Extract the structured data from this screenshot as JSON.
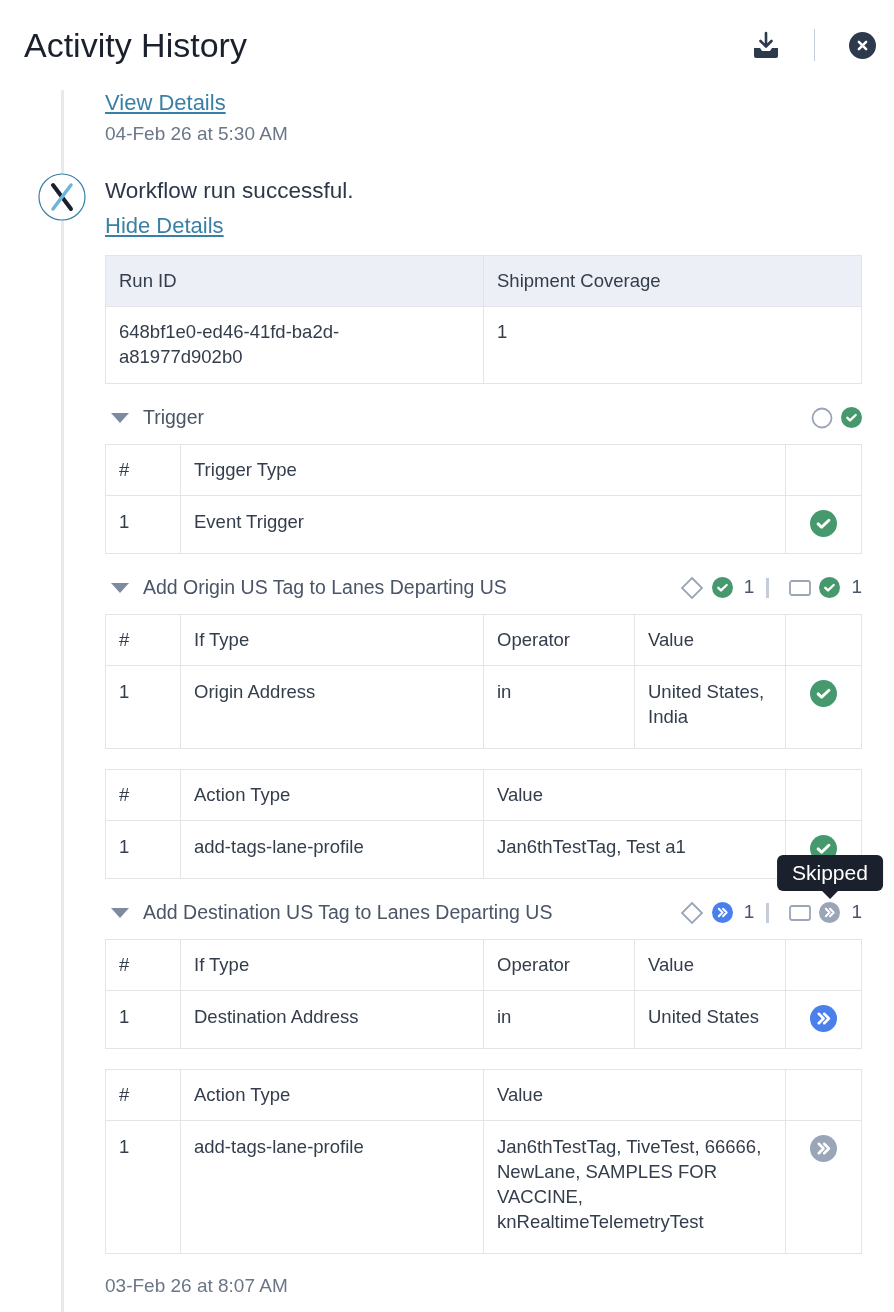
{
  "header": {
    "title": "Activity History"
  },
  "previous_entry": {
    "link": "View Details",
    "timestamp": "04-Feb 26 at 5:30 AM"
  },
  "entry": {
    "message": "Workflow run successful.",
    "link": "Hide Details",
    "timestamp": "03-Feb 26 at 8:07 AM",
    "run_table": {
      "columns": [
        "Run ID",
        "Shipment Coverage"
      ],
      "rows": [
        [
          "648bf1e0-ed46-41fd-ba2d-a81977d902b0",
          "1"
        ]
      ]
    },
    "sections": [
      {
        "title": "Trigger",
        "expanded": true,
        "indicators": [
          {
            "kind": "trigger",
            "icon": {
              "kind": "check",
              "color": "#46996c"
            }
          }
        ],
        "tables": [
          {
            "kind": "trigger",
            "columns": [
              "#",
              "Trigger Type"
            ],
            "rows": [
              {
                "cells": [
                  "1",
                  "Event Trigger"
                ],
                "icon": {
                  "kind": "check",
                  "color": "#46996c"
                }
              }
            ]
          }
        ]
      },
      {
        "title": "Add Origin US Tag to Lanes Departing US",
        "expanded": true,
        "indicators": [
          {
            "kind": "condition",
            "icon": {
              "kind": "check",
              "color": "#46996c"
            },
            "count": "1"
          },
          {
            "kind": "action",
            "icon": {
              "kind": "check",
              "color": "#46996c"
            },
            "count": "1"
          }
        ],
        "tables": [
          {
            "kind": "condition",
            "columns": [
              "#",
              "If Type",
              "Operator",
              "Value"
            ],
            "rows": [
              {
                "cells": [
                  "1",
                  "Origin Address",
                  "in",
                  "United States, India"
                ],
                "icon": {
                  "kind": "check",
                  "color": "#46996c"
                }
              }
            ]
          },
          {
            "kind": "action",
            "columns": [
              "#",
              "Action Type",
              "Value"
            ],
            "rows": [
              {
                "cells": [
                  "1",
                  "add-tags-lane-profile",
                  "Jan6thTestTag, Test a1"
                ],
                "icon": {
                  "kind": "check",
                  "color": "#46996c"
                }
              }
            ]
          }
        ]
      },
      {
        "title": "Add Destination US Tag to Lanes Departing US",
        "expanded": true,
        "indicators": [
          {
            "kind": "condition",
            "icon": {
              "kind": "skip",
              "color": "#4a80ec"
            },
            "count": "1"
          },
          {
            "kind": "action",
            "icon": {
              "kind": "skip",
              "color": "#9aa5b8"
            },
            "count": "1",
            "tooltip": "Skipped"
          }
        ],
        "tables": [
          {
            "kind": "condition",
            "columns": [
              "#",
              "If Type",
              "Operator",
              "Value"
            ],
            "rows": [
              {
                "cells": [
                  "1",
                  "Destination Address",
                  "in",
                  "United States"
                ],
                "icon": {
                  "kind": "skip",
                  "color": "#4a80ec"
                }
              }
            ]
          },
          {
            "kind": "action",
            "columns": [
              "#",
              "Action Type",
              "Value"
            ],
            "rows": [
              {
                "cells": [
                  "1",
                  "add-tags-lane-profile",
                  "Jan6thTestTag, TiveTest, 66666, NewLane, SAMPLES FOR VACCINE, knRealtimeTelemetryTest"
                ],
                "icon": {
                  "kind": "skip",
                  "color": "#9aa5b8"
                }
              }
            ]
          }
        ]
      }
    ]
  }
}
